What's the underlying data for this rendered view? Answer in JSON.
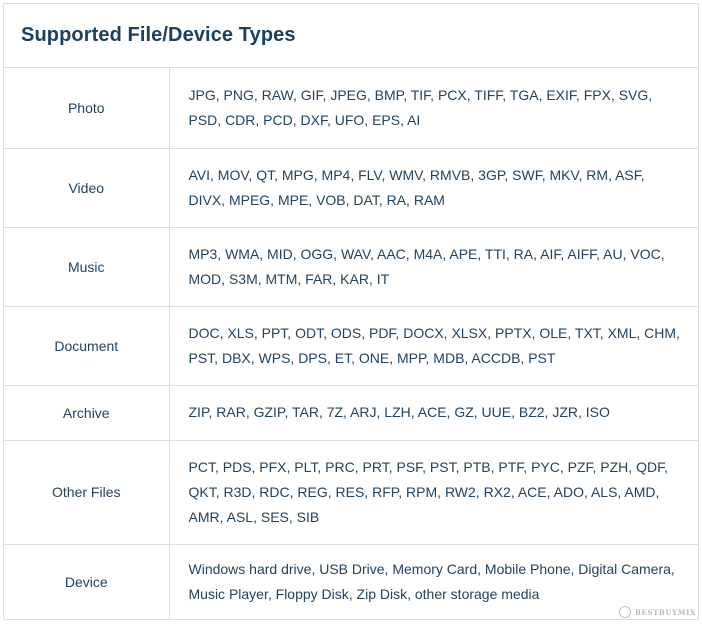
{
  "title": "Supported File/Device Types",
  "rows": [
    {
      "category": "Photo",
      "types": "JPG, PNG, RAW, GIF, JPEG, BMP, TIF, PCX, TIFF, TGA, EXIF, FPX, SVG, PSD, CDR, PCD, DXF, UFO, EPS, AI"
    },
    {
      "category": "Video",
      "types": "AVI, MOV, QT, MPG, MP4, FLV, WMV, RMVB, 3GP, SWF, MKV, RM, ASF, DIVX, MPEG, MPE, VOB, DAT, RA, RAM"
    },
    {
      "category": "Music",
      "types": "MP3, WMA, MID, OGG, WAV, AAC, M4A, APE, TTI, RA, AIF, AIFF, AU, VOC, MOD, S3M, MTM, FAR, KAR, IT"
    },
    {
      "category": "Document",
      "types": "DOC, XLS, PPT, ODT, ODS, PDF, DOCX, XLSX, PPTX, OLE, TXT, XML, CHM, PST, DBX, WPS, DPS, ET, ONE, MPP, MDB, ACCDB, PST"
    },
    {
      "category": "Archive",
      "types": "ZIP, RAR, GZIP, TAR, 7Z, ARJ, LZH, ACE, GZ, UUE, BZ2, JZR, ISO"
    },
    {
      "category": "Other Files",
      "types": "PCT, PDS, PFX, PLT, PRC, PRT, PSF, PST, PTB, PTF, PYC, PZF, PZH, QDF, QKT, R3D, RDC, REG, RES, RFP, RPM, RW2, RX2, ACE, ADO, ALS, AMD, AMR, ASL, SES, SIB"
    },
    {
      "category": "Device",
      "types": "Windows hard drive, USB Drive, Memory Card, Mobile Phone, Digital Camera, Music Player, Floppy Disk, Zip Disk, other storage media"
    }
  ],
  "watermark": {
    "text": "BESTBUYMIX",
    "icon": "bestbuymix-logo-icon"
  }
}
